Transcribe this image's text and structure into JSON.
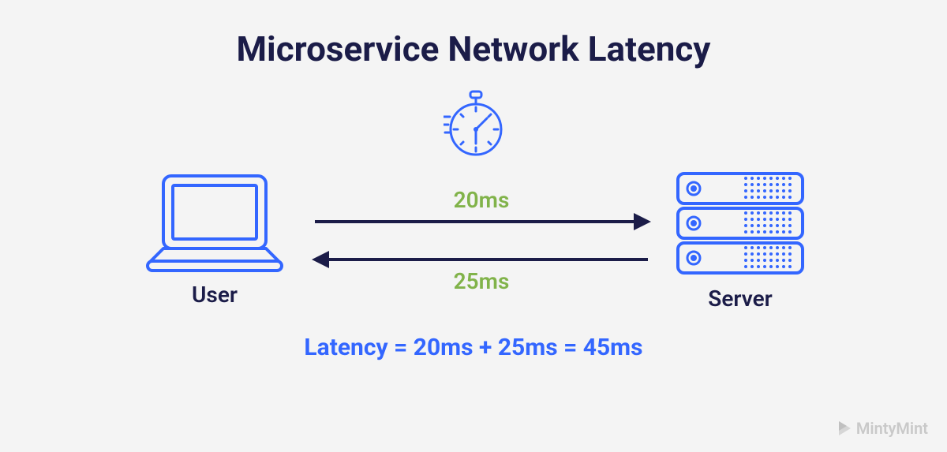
{
  "title": "Microservice Network Latency",
  "user_label": "User",
  "server_label": "Server",
  "request_ms": "20ms",
  "response_ms": "25ms",
  "formula": "Latency = 20ms + 25ms = 45ms",
  "brand": "MintyMint",
  "colors": {
    "accent_blue": "#3366ff",
    "navy": "#1b1c48",
    "green": "#81b34a",
    "bg": "#f4f4f4",
    "brand_gray": "#c9c9c9"
  }
}
